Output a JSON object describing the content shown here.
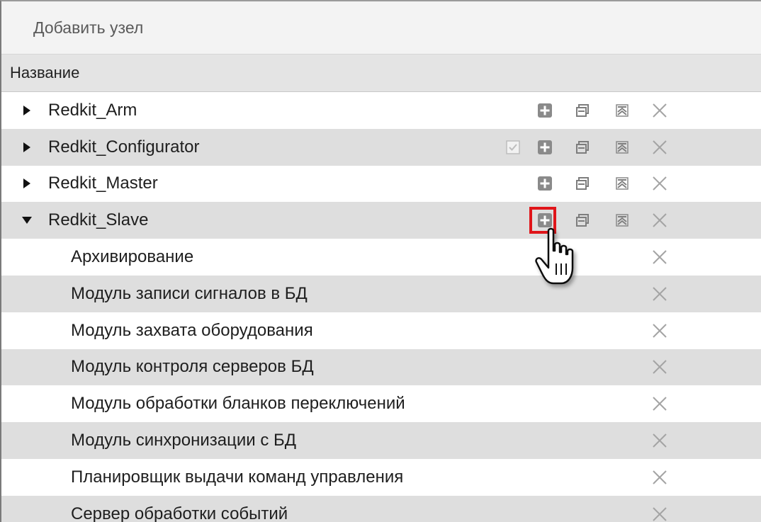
{
  "toolbar": {
    "add_node_label": "Добавить узел"
  },
  "table": {
    "column_header": "Название"
  },
  "nodes": [
    {
      "label": "Redkit_Arm"
    },
    {
      "label": "Redkit_Configurator"
    },
    {
      "label": "Redkit_Master"
    },
    {
      "label": "Redkit_Slave"
    }
  ],
  "children": [
    {
      "label": "Архивирование"
    },
    {
      "label": "Модуль записи сигналов в БД"
    },
    {
      "label": "Модуль захвата оборудования"
    },
    {
      "label": "Модуль контроля серверов БД"
    },
    {
      "label": "Модуль обработки бланков переключений"
    },
    {
      "label": "Модуль синхронизации с БД"
    },
    {
      "label": "Планировщик выдачи команд управления"
    },
    {
      "label": "Сервер обработки событий"
    }
  ],
  "icons": {
    "expand": "triangle-right-icon",
    "collapse": "triangle-down-icon",
    "add": "plus-square-icon",
    "duplicate": "copy-window-icon",
    "move_up": "move-up-icon",
    "delete": "close-x-icon",
    "checkbox": "checkbox-icon",
    "cursor": "hand-pointer-icon"
  },
  "colors": {
    "highlight": "#e0151a",
    "row_alt": "#dedede",
    "icon_fill": "#8a8a8a"
  }
}
